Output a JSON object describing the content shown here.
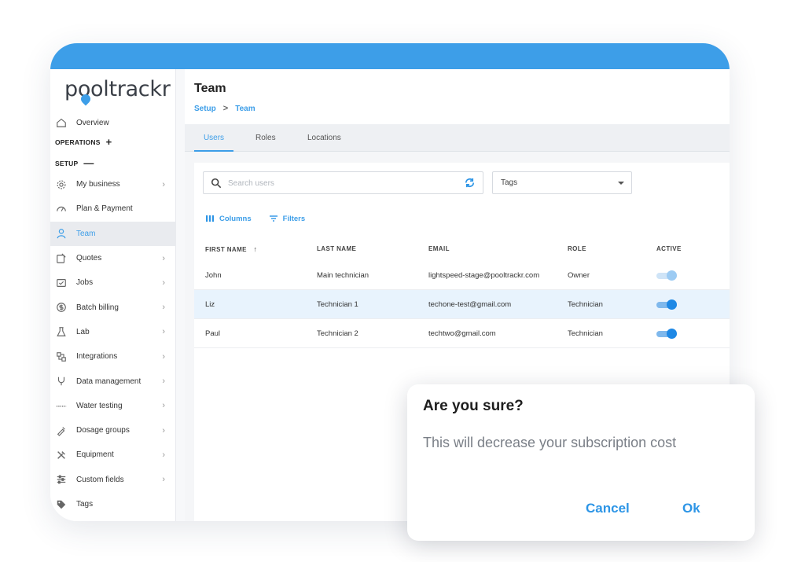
{
  "app": {
    "logo_text": "pooltrackr",
    "brand_color": "#3d9ee8"
  },
  "sidebar": {
    "overview": "Overview",
    "operations": {
      "label": "OPERATIONS",
      "symbol": "+"
    },
    "setup": {
      "label": "SETUP",
      "symbol": "—"
    },
    "items": [
      {
        "label": "My business",
        "icon": "gear-icon",
        "chevron": true
      },
      {
        "label": "Plan & Payment",
        "icon": "gauge-icon",
        "chevron": false
      },
      {
        "label": "Team",
        "icon": "person-icon",
        "chevron": false,
        "active": true
      },
      {
        "label": "Quotes",
        "icon": "quote-icon",
        "chevron": true
      },
      {
        "label": "Jobs",
        "icon": "jobs-icon",
        "chevron": true
      },
      {
        "label": "Batch billing",
        "icon": "dollar-icon",
        "chevron": true
      },
      {
        "label": "Lab",
        "icon": "flask-icon",
        "chevron": true
      },
      {
        "label": "Integrations",
        "icon": "integrations-icon",
        "chevron": true
      },
      {
        "label": "Data management",
        "icon": "data-icon",
        "chevron": true
      },
      {
        "label": "Water testing",
        "icon": "water-test-icon",
        "chevron": true
      },
      {
        "label": "Dosage groups",
        "icon": "dropper-icon",
        "chevron": true
      },
      {
        "label": "Equipment",
        "icon": "tools-icon",
        "chevron": true
      },
      {
        "label": "Custom fields",
        "icon": "sliders-icon",
        "chevron": true
      },
      {
        "label": "Tags",
        "icon": "tag-icon",
        "chevron": false
      }
    ]
  },
  "header": {
    "title": "Team",
    "breadcrumb": {
      "parent": "Setup",
      "separator": ">",
      "current": "Team"
    }
  },
  "tabs": [
    {
      "label": "Users",
      "active": true
    },
    {
      "label": "Roles",
      "active": false
    },
    {
      "label": "Locations",
      "active": false
    }
  ],
  "search": {
    "placeholder": "Search users",
    "value": ""
  },
  "tags_filter": {
    "label": "Tags"
  },
  "toolbar": {
    "columns_label": "Columns",
    "filters_label": "Filters"
  },
  "table": {
    "columns": [
      "FIRST NAME",
      "LAST NAME",
      "EMAIL",
      "ROLE",
      "ACTIVE"
    ],
    "sort_indicator": "↑",
    "rows": [
      {
        "first_name": "John",
        "last_name": "Main technician",
        "email": "lightspeed-stage@pooltrackr.com",
        "role": "Owner",
        "active": true,
        "disabled": true,
        "selected": false
      },
      {
        "first_name": "Liz",
        "last_name": "Technician 1",
        "email": "techone-test@gmail.com",
        "role": "Technician",
        "active": true,
        "disabled": false,
        "selected": true
      },
      {
        "first_name": "Paul",
        "last_name": "Technician 2",
        "email": "techtwo@gmail.com",
        "role": "Technician",
        "active": true,
        "disabled": false,
        "selected": false
      }
    ]
  },
  "dialog": {
    "title": "Are you sure?",
    "message": "This will decrease your subscription cost",
    "cancel_label": "Cancel",
    "ok_label": "Ok"
  }
}
